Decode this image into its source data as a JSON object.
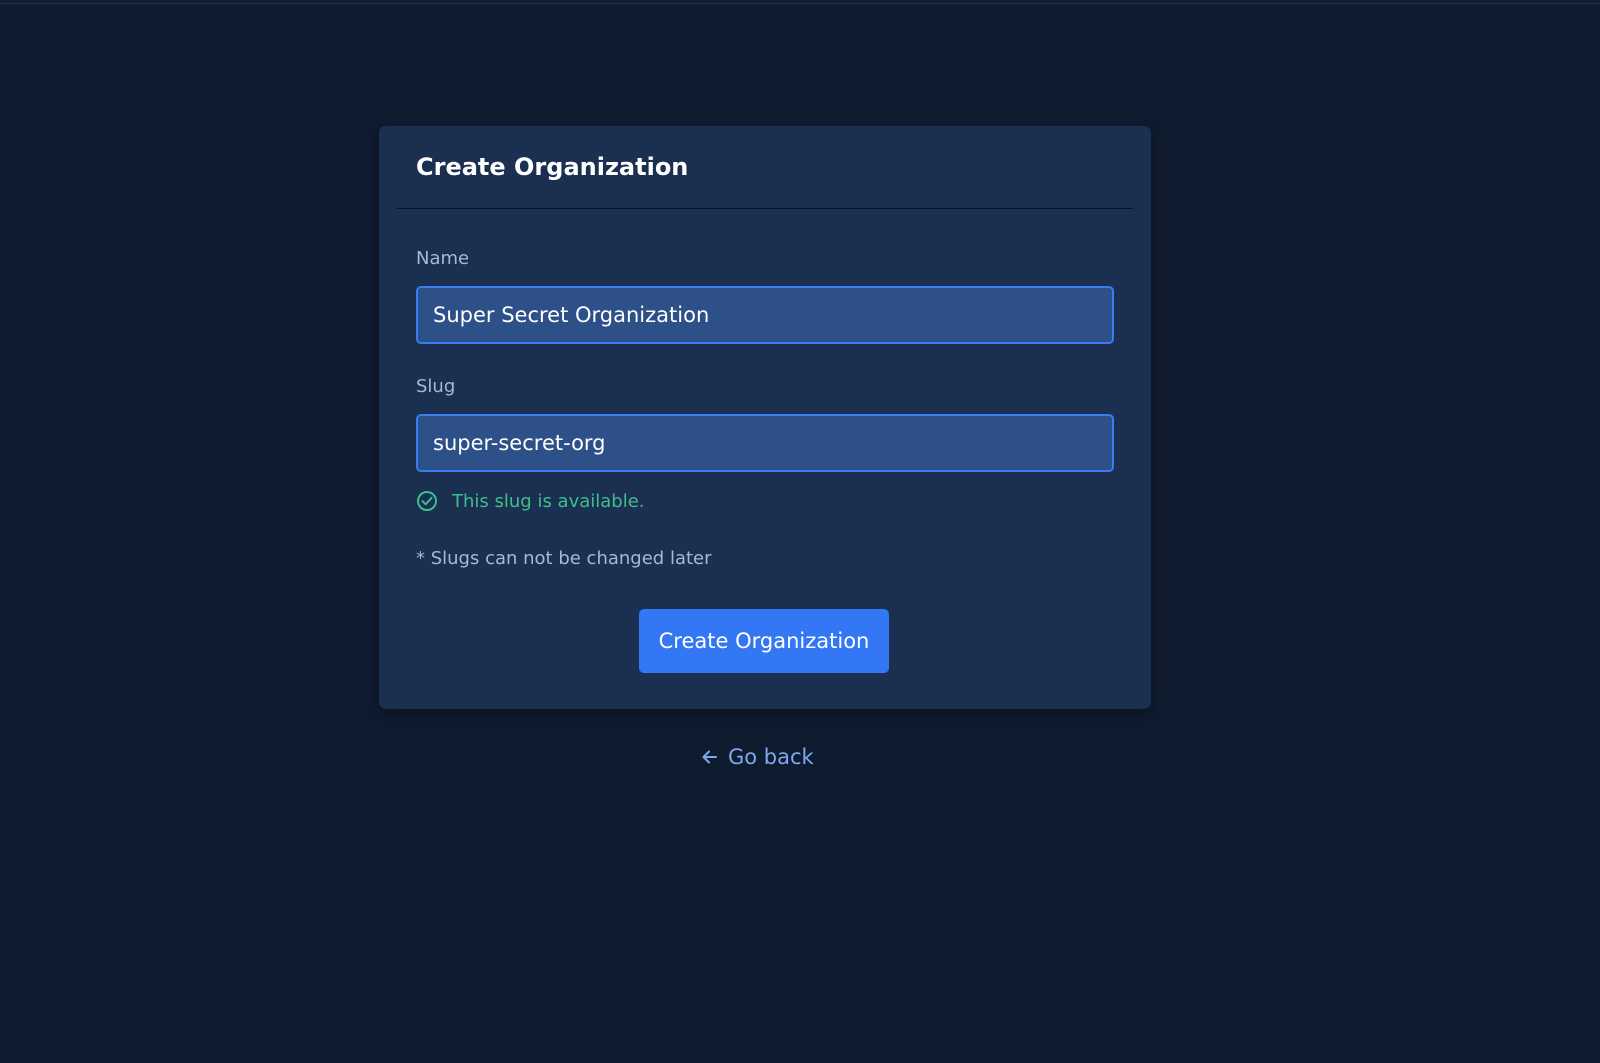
{
  "card": {
    "title": "Create Organization"
  },
  "form": {
    "name": {
      "label": "Name",
      "value": "Super Secret Organization"
    },
    "slug": {
      "label": "Slug",
      "value": "super-secret-org",
      "availability": "This slug is available.",
      "availability_icon": "check-circle-icon"
    },
    "note": "* Slugs can not be changed later",
    "submit_label": "Create Organization"
  },
  "nav": {
    "go_back_label": "Go back",
    "go_back_icon": "arrow-left-icon"
  },
  "colors": {
    "background": "#0f1b2f",
    "card": "#1b2f50",
    "input_bg": "#2c5087",
    "input_border": "#3b7cf0",
    "primary": "#3377f5",
    "success": "#3dbf8a",
    "link": "#7ea9ee"
  }
}
